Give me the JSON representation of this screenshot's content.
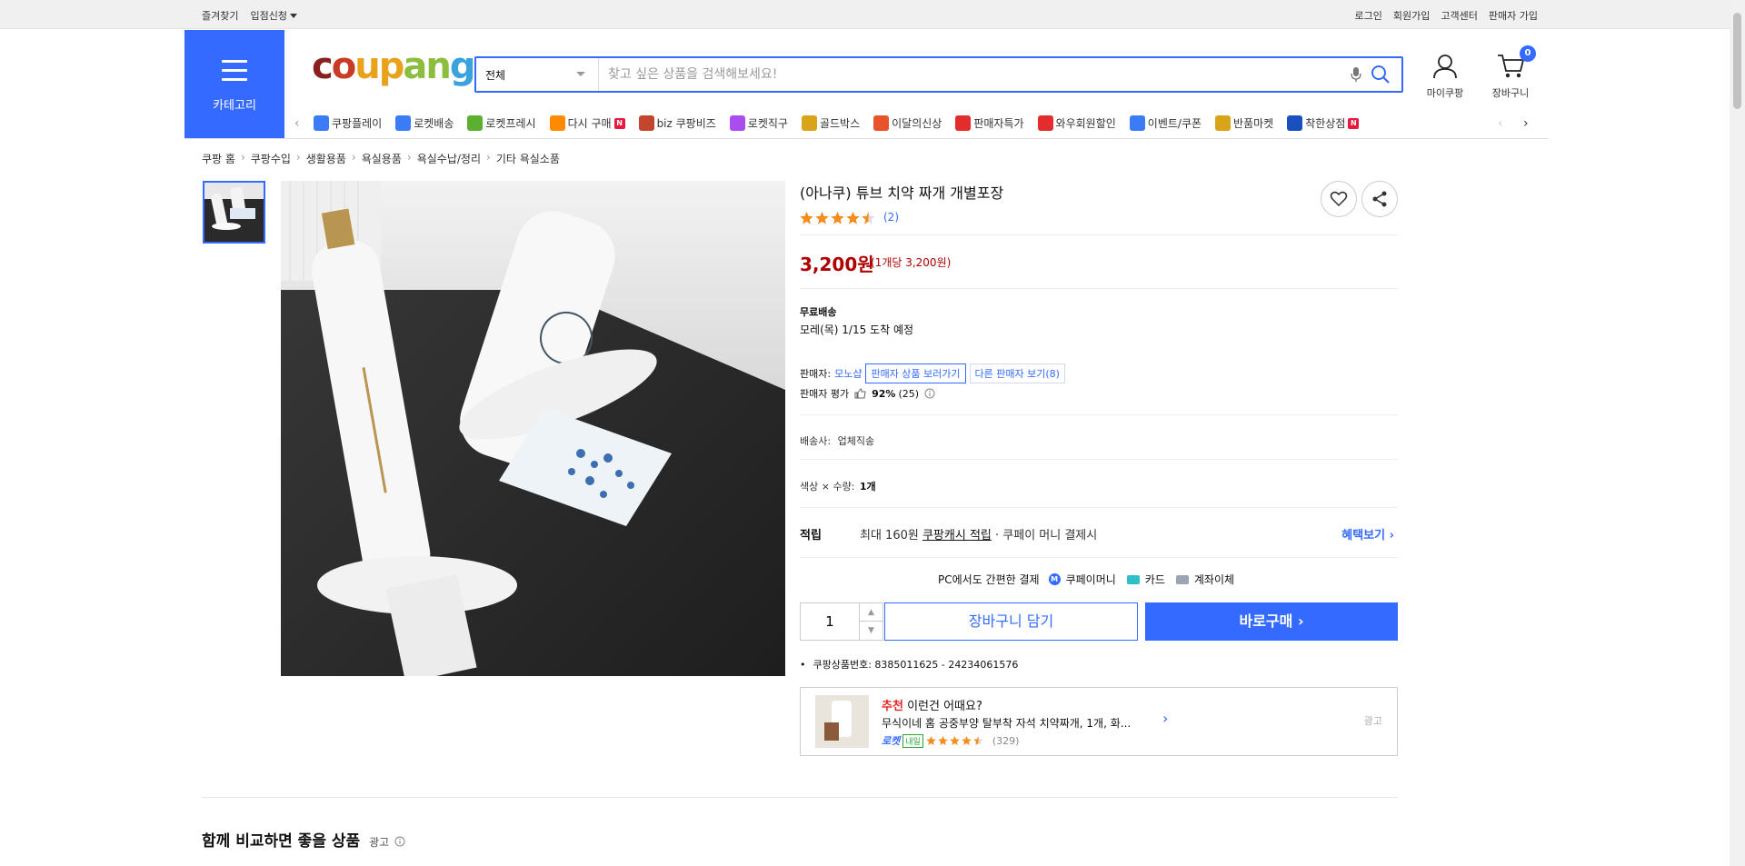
{
  "topbar": {
    "left": [
      "즐겨찾기",
      "입점신청"
    ],
    "right": [
      "로그인",
      "회원가입",
      "고객센터",
      "판매자 가입"
    ]
  },
  "header": {
    "category_label": "카테고리",
    "logo": [
      "c",
      "o",
      "u",
      "p",
      "a",
      "n",
      "g"
    ],
    "search_scope": "전체",
    "search_placeholder": "찾고 싶은 상품을 검색해보세요!",
    "mycoupang": "마이쿠팡",
    "cart": "장바구니",
    "cart_count": "0"
  },
  "nav": {
    "items": [
      {
        "label": "쿠팡플레이",
        "color": "#3b7cf6"
      },
      {
        "label": "로켓배송",
        "color": "#3b7cf6"
      },
      {
        "label": "로켓프레시",
        "color": "#5bb030"
      },
      {
        "label": "다시 구매",
        "color": "#ff8a00",
        "badge": "N"
      },
      {
        "label": "biz 쿠팡비즈",
        "color": "#c4452b"
      },
      {
        "label": "로켓직구",
        "color": "#a94df0"
      },
      {
        "label": "골드박스",
        "color": "#d8a41a"
      },
      {
        "label": "이달의신상",
        "color": "#e8532b"
      },
      {
        "label": "판매자특가",
        "color": "#e32d2d"
      },
      {
        "label": "와우회원할인",
        "color": "#e32d2d"
      },
      {
        "label": "이벤트/쿠폰",
        "color": "#3b7cf6"
      },
      {
        "label": "반품마켓",
        "color": "#d8a41a"
      },
      {
        "label": "착한상점",
        "color": "#1a4fc0",
        "badge": "N"
      }
    ]
  },
  "breadcrumb": [
    "쿠팡 홈",
    "쿠팡수입",
    "생활용품",
    "욕실용품",
    "욕실수납/정리",
    "기타 욕실소품"
  ],
  "product": {
    "title": "(아나쿠) 튜브 치약 짜개 개별포장",
    "rating_count": "(2)",
    "rating_stars": 4.5,
    "price": "3,200원",
    "unit_price": "(1개당 3,200원)",
    "ship_type": "무료배송",
    "ship_date": "모레(목) 1/15 도착 예정",
    "seller_label": "판매자:",
    "seller_name": "모노샵",
    "seller_products_btn": "판매자 상품 보러가기",
    "other_sellers_btn": "다른 판매자 보기(8)",
    "seller_rating_label": "판매자 평가",
    "seller_rating": "92%",
    "seller_rating_count": "(25)",
    "carrier_label": "배송사:",
    "carrier": "업체직송",
    "option_label": "색상 × 수량:",
    "option_value": "1개",
    "cash_label": "적립",
    "cash_text_1": "최대 160원",
    "cash_link": "쿠팡캐시 적립",
    "cash_text_2": "· 쿠페이 머니 결제시",
    "cash_more": "혜택보기",
    "pay_title": "PC에서도 간편한 결제",
    "pay_methods": [
      "쿠페이머니",
      "카드",
      "계좌이체"
    ],
    "quantity": "1",
    "add_cart": "장바구니 담기",
    "buy_now": "바로구매",
    "product_id": "쿠팡상품번호: 8385011625 - 24234061576"
  },
  "recommend": {
    "tag": "추천",
    "title": "이런건 어때요?",
    "item": "무식이네 홈 공중부양 탈부착 자석 치약짜개, 1개, 화...",
    "rocket": "로켓",
    "tomorrow": "내일",
    "rating_count": "(329)",
    "rating_stars": 4.5,
    "ad": "광고"
  },
  "compare": {
    "title": "함께 비교하면 좋을 상품",
    "ad": "광고"
  }
}
